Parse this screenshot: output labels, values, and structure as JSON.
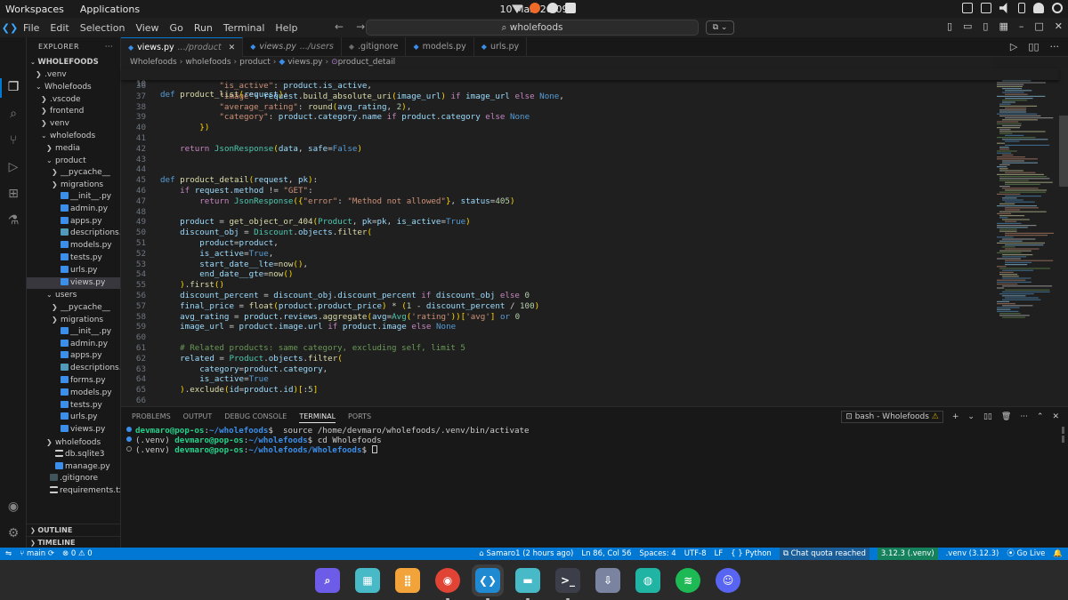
{
  "os": {
    "workspaces": "Workspaces",
    "applications": "Applications",
    "clock": "10 Mar, 20:09"
  },
  "titlebar": {
    "menus": [
      "File",
      "Edit",
      "Selection",
      "View",
      "Go",
      "Run",
      "Terminal",
      "Help"
    ],
    "search": "wholefoods"
  },
  "explorer": {
    "title": "EXPLORER",
    "root": "WHOLEFOODS",
    "items": [
      {
        "label": ".venv",
        "depth": 1,
        "kind": "folder",
        "open": false
      },
      {
        "label": "Wholefoods",
        "depth": 1,
        "kind": "folder",
        "open": true
      },
      {
        "label": ".vscode",
        "depth": 2,
        "kind": "folder",
        "open": false
      },
      {
        "label": "frontend",
        "depth": 2,
        "kind": "folder",
        "open": false
      },
      {
        "label": "venv",
        "depth": 2,
        "kind": "folder",
        "open": false
      },
      {
        "label": "wholefoods",
        "depth": 2,
        "kind": "folder",
        "open": true
      },
      {
        "label": "media",
        "depth": 3,
        "kind": "folder",
        "open": false
      },
      {
        "label": "product",
        "depth": 3,
        "kind": "folder",
        "open": true
      },
      {
        "label": "__pycache__",
        "depth": 4,
        "kind": "folder",
        "open": false
      },
      {
        "label": "migrations",
        "depth": 4,
        "kind": "folder",
        "open": false
      },
      {
        "label": "__init__.py",
        "depth": 4,
        "kind": "py"
      },
      {
        "label": "admin.py",
        "depth": 4,
        "kind": "py"
      },
      {
        "label": "apps.py",
        "depth": 4,
        "kind": "py"
      },
      {
        "label": "descriptions.md",
        "depth": 4,
        "kind": "md"
      },
      {
        "label": "models.py",
        "depth": 4,
        "kind": "py"
      },
      {
        "label": "tests.py",
        "depth": 4,
        "kind": "py"
      },
      {
        "label": "urls.py",
        "depth": 4,
        "kind": "py"
      },
      {
        "label": "views.py",
        "depth": 4,
        "kind": "py",
        "selected": true
      },
      {
        "label": "users",
        "depth": 3,
        "kind": "folder",
        "open": true
      },
      {
        "label": "__pycache__",
        "depth": 4,
        "kind": "folder",
        "open": false
      },
      {
        "label": "migrations",
        "depth": 4,
        "kind": "folder",
        "open": false
      },
      {
        "label": "__init__.py",
        "depth": 4,
        "kind": "py"
      },
      {
        "label": "admin.py",
        "depth": 4,
        "kind": "py"
      },
      {
        "label": "apps.py",
        "depth": 4,
        "kind": "py"
      },
      {
        "label": "descriptions.md",
        "depth": 4,
        "kind": "md"
      },
      {
        "label": "forms.py",
        "depth": 4,
        "kind": "py"
      },
      {
        "label": "models.py",
        "depth": 4,
        "kind": "py"
      },
      {
        "label": "tests.py",
        "depth": 4,
        "kind": "py"
      },
      {
        "label": "urls.py",
        "depth": 4,
        "kind": "py"
      },
      {
        "label": "views.py",
        "depth": 4,
        "kind": "py"
      },
      {
        "label": "wholefoods",
        "depth": 3,
        "kind": "folder",
        "open": false
      },
      {
        "label": "db.sqlite3",
        "depth": 3,
        "kind": "db"
      },
      {
        "label": "manage.py",
        "depth": 3,
        "kind": "py"
      },
      {
        "label": ".gitignore",
        "depth": 2,
        "kind": "git"
      },
      {
        "label": "requirements.txt",
        "depth": 2,
        "kind": "txt"
      }
    ],
    "outline": "OUTLINE",
    "timeline": "TIMELINE"
  },
  "tabs": [
    {
      "name": "views.py",
      "hint": ".../product",
      "icon": "py",
      "active": true
    },
    {
      "name": "views.py",
      "hint": ".../users",
      "icon": "py",
      "active": false,
      "italic": true
    },
    {
      "name": ".gitignore",
      "hint": "",
      "icon": "git",
      "active": false
    },
    {
      "name": "models.py",
      "hint": "",
      "icon": "py",
      "active": false
    },
    {
      "name": "urls.py",
      "hint": "",
      "icon": "py",
      "active": false
    }
  ],
  "breadcrumb": [
    "Wholefoods",
    "wholefoods",
    "product",
    "views.py",
    "product_detail"
  ],
  "sticky": {
    "ln": "10",
    "code": "def product_list(request):"
  },
  "code": [
    {
      "ln": "36",
      "code": "            \"is_active\": product.is_active,"
    },
    {
      "ln": "37",
      "code": "            \"image\": request.build_absolute_uri(image_url) if image_url else None,"
    },
    {
      "ln": "38",
      "code": "            \"average_rating\": round(avg_rating, 2),"
    },
    {
      "ln": "39",
      "code": "            \"category\": product.category.name if product.category else None"
    },
    {
      "ln": "40",
      "code": "        })"
    },
    {
      "ln": "41",
      "code": ""
    },
    {
      "ln": "42",
      "code": "    return JsonResponse(data, safe=False)"
    },
    {
      "ln": "43",
      "code": ""
    },
    {
      "ln": "44",
      "code": ""
    },
    {
      "ln": "45",
      "code": "def product_detail(request, pk):"
    },
    {
      "ln": "46",
      "code": "    if request.method != \"GET\":"
    },
    {
      "ln": "47",
      "code": "        return JsonResponse({\"error\": \"Method not allowed\"}, status=405)"
    },
    {
      "ln": "48",
      "code": ""
    },
    {
      "ln": "49",
      "code": "    product = get_object_or_404(Product, pk=pk, is_active=True)"
    },
    {
      "ln": "50",
      "code": "    discount_obj = Discount.objects.filter("
    },
    {
      "ln": "51",
      "code": "        product=product,"
    },
    {
      "ln": "52",
      "code": "        is_active=True,"
    },
    {
      "ln": "53",
      "code": "        start_date__lte=now(),"
    },
    {
      "ln": "54",
      "code": "        end_date__gte=now()"
    },
    {
      "ln": "55",
      "code": "    ).first()"
    },
    {
      "ln": "56",
      "code": "    discount_percent = discount_obj.discount_percent if discount_obj else 0"
    },
    {
      "ln": "57",
      "code": "    final_price = float(product.product_price) * (1 - discount_percent / 100)"
    },
    {
      "ln": "58",
      "code": "    avg_rating = product.reviews.aggregate(avg=Avg('rating'))['avg'] or 0"
    },
    {
      "ln": "59",
      "code": "    image_url = product.image.url if product.image else None"
    },
    {
      "ln": "60",
      "code": ""
    },
    {
      "ln": "61",
      "code": "    # Related products: same category, excluding self, limit 5"
    },
    {
      "ln": "62",
      "code": "    related = Product.objects.filter("
    },
    {
      "ln": "63",
      "code": "        category=product.category,"
    },
    {
      "ln": "64",
      "code": "        is_active=True"
    },
    {
      "ln": "65",
      "code": "    ).exclude(id=product.id)[:5]"
    },
    {
      "ln": "66",
      "code": ""
    }
  ],
  "panel": {
    "tabs": [
      "PROBLEMS",
      "OUTPUT",
      "DEBUG CONSOLE",
      "TERMINAL",
      "PORTS"
    ],
    "active_tab": "TERMINAL",
    "terminal_name": "bash - Wholefoods",
    "lines": [
      {
        "marker": "blue",
        "venv": "",
        "user": "devmaro@pop-os",
        "path": "~/wholefoods",
        "cmd": "  source /home/devmaro/wholefoods/.venv/bin/activate"
      },
      {
        "marker": "blue",
        "venv": "(.venv) ",
        "user": "devmaro@pop-os",
        "path": "~/wholefoods",
        "cmd": " cd Wholefoods"
      },
      {
        "marker": "hollow",
        "venv": "(.venv) ",
        "user": "devmaro@pop-os",
        "path": "~/wholefoods/Wholefoods",
        "cmd": " "
      }
    ]
  },
  "status": {
    "branch": "main",
    "problems": "0",
    "warnings": "0",
    "blame": "Samaro1 (2 hours ago)",
    "cursor": "Ln 86, Col 56",
    "spaces": "Spaces: 4",
    "encoding": "UTF-8",
    "eol": "LF",
    "language": "Python",
    "chat": "Chat quota reached",
    "interpreter": "3.12.3 (.venv)",
    "venv": ".venv (3.12.3)",
    "golive": "Go Live"
  },
  "dock": [
    {
      "name": "app-launcher",
      "color": "#6c5ce7"
    },
    {
      "name": "workspaces",
      "color": "#48b9c7"
    },
    {
      "name": "app-grid",
      "color": "#f2a33a"
    },
    {
      "name": "chrome",
      "color": "#e14434"
    },
    {
      "name": "vscode",
      "color": "#1f8ad2"
    },
    {
      "name": "files",
      "color": "#48b9c7"
    },
    {
      "name": "terminal",
      "color": "#3c3f49"
    },
    {
      "name": "download",
      "color": "#7a84a0"
    },
    {
      "name": "settings",
      "color": "#1fb4a4"
    },
    {
      "name": "spotify",
      "color": "#1db954"
    },
    {
      "name": "discord",
      "color": "#5865f2"
    }
  ]
}
